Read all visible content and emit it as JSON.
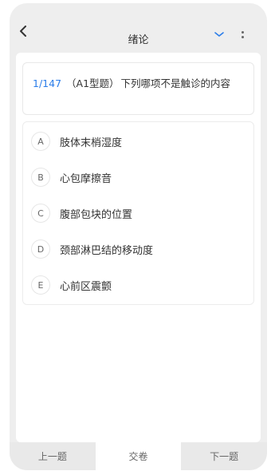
{
  "header": {
    "title": "绪论"
  },
  "question": {
    "index": "1/147",
    "type": "（A1型题）",
    "text": "下列哪项不是触诊的内容"
  },
  "options": [
    {
      "letter": "A",
      "text": "肢体末梢湿度"
    },
    {
      "letter": "B",
      "text": "心包摩擦音"
    },
    {
      "letter": "C",
      "text": "腹部包块的位置"
    },
    {
      "letter": "D",
      "text": "颈部淋巴结的移动度"
    },
    {
      "letter": "E",
      "text": "心前区震颤"
    }
  ],
  "footer": {
    "prev_label": "上一题",
    "submit_label": "交卷",
    "next_label": "下一题"
  },
  "colors": {
    "accent": "#2b7de9",
    "background": "#eeeeee"
  }
}
